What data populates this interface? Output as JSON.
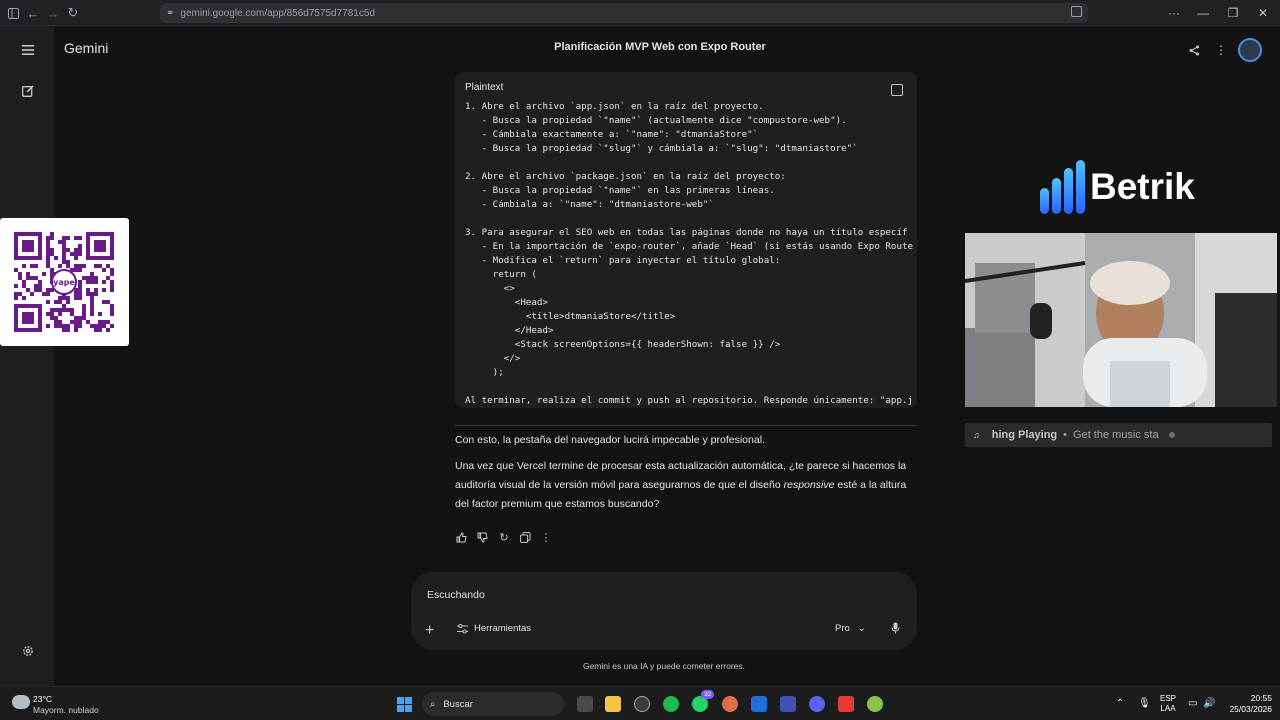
{
  "browser": {
    "url": "gemini.google.com/app/856d7575d7781c5d",
    "icons": [
      "sidebar-icon",
      "back-icon",
      "forward-icon",
      "reload-icon",
      "site-info-icon",
      "reader-icon",
      "more-icon",
      "minimize-icon",
      "maximize-icon",
      "close-icon"
    ]
  },
  "app": {
    "brand": "Gemini",
    "chat_title": "Planificación MVP Web con Expo Router"
  },
  "code_block": {
    "language": "Plaintext",
    "lines": [
      "1. Abre el archivo `app.json` en la raíz del proyecto.",
      "   - Busca la propiedad `\"name\"` (actualmente dice \"compustore-web\").",
      "   - Cámbiala exactamente a: `\"name\": \"dtmaniaStore\"`",
      "   - Busca la propiedad `\"slug\"` y cámbiala a: `\"slug\": \"dtmaniastore\"`",
      "",
      "2. Abre el archivo `package.json` en la raíz del proyecto:",
      "   - Busca la propiedad `\"name\"` en las primeras líneas.",
      "   - Cámbiala a: `\"name\": \"dtmaniastore-web\"`",
      "",
      "3. Para asegurar el SEO web en todas las páginas donde no haya un título específ",
      "   - En la importación de `expo-router`, añade `Head` (si estás usando Expo Route",
      "   - Modifica el `return` para inyectar el título global:",
      "     return (",
      "       <>",
      "         <Head>",
      "           <title>dtmaniaStore</title>",
      "         </Head>",
      "         <Stack screenOptions={{ headerShown: false }} />",
      "       </>",
      "     );",
      "",
      "Al terminar, realiza el commit y push al repositorio. Responde únicamente: \"app.j"
    ]
  },
  "response": {
    "para1": "Con esto, la pestaña del navegador lucirá impecable y profesional.",
    "para2_a": "Una vez que Vercel termine de procesar esta actualización automática, ¿te parece si hacemos la auditoría visual de la versión móvil para asegurarnos de que el diseño ",
    "para2_em": "responsive",
    "para2_b": " esté a la altura del factor premium que estamos buscando?"
  },
  "actions": [
    "thumbs-up-icon",
    "thumbs-down-icon",
    "regenerate-icon",
    "copy-icon",
    "more-vert-icon"
  ],
  "input": {
    "text": "Escuchando",
    "tools_label": "Herramientas",
    "mode_label": "Pro"
  },
  "disclaimer": "Gemini es una IA y puede cometer errores.",
  "overlays": {
    "brand": "Betrik",
    "now_playing_title": "hing Playing",
    "now_playing_sep": "•",
    "now_playing_text": "Get the music sta",
    "qr_label": "yape"
  },
  "taskbar": {
    "weather_temp": "23°C",
    "weather_desc": "Mayorm. nublado",
    "search_placeholder": "Buscar",
    "lang_1": "ESP",
    "lang_2": "LAA",
    "time": "20:55",
    "date": "25/03/2026",
    "badges": {
      "whatsapp": "32"
    }
  },
  "colors": {
    "background": "#131314",
    "surface": "#1e1f20",
    "text": "#e3e3e3",
    "accent_blue": "#3ea6ff",
    "qr_purple": "#6a1b8a"
  }
}
